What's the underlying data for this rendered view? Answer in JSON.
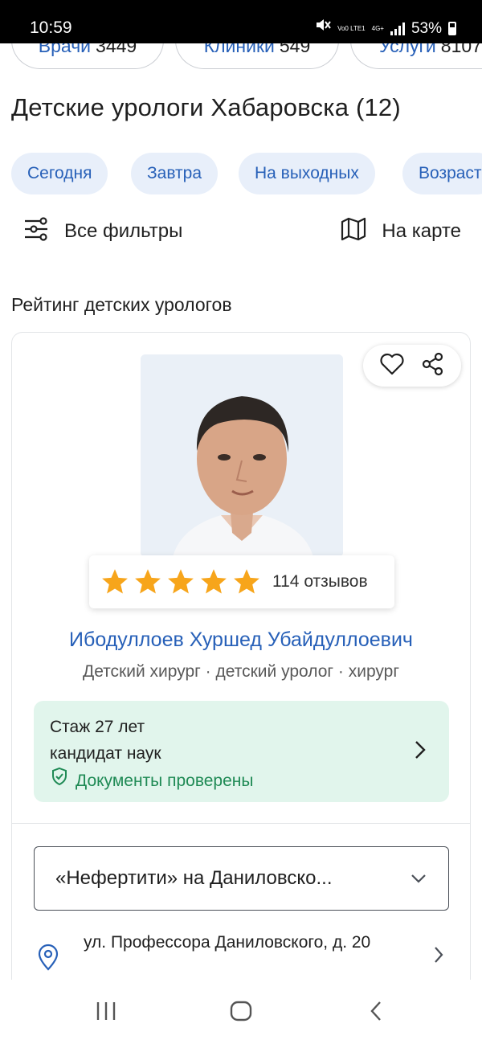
{
  "status_bar": {
    "time": "10:59",
    "battery": "53%",
    "net_top": "Vo0 LTE1",
    "net_right": "4G+"
  },
  "counters": [
    {
      "label": "Врачи",
      "value": "3449"
    },
    {
      "label": "Клиники",
      "value": "549"
    },
    {
      "label": "Услуги",
      "value": "8107"
    }
  ],
  "page_title": "Детские урологи Хабаровска (12)",
  "chips": [
    "Сегодня",
    "Завтра",
    "На выходных",
    "Возраст"
  ],
  "filters": {
    "all_filters": "Все фильтры",
    "on_map": "На карте"
  },
  "section_title": "Рейтинг детских урологов",
  "doctor": {
    "rating_stars": 5,
    "reviews": "114 отзывов",
    "name": "Ибодуллоев Хуршед Убайдуллоевич",
    "specialties": "Детский хирург · детский уролог · хирург",
    "experience": "Стаж 27 лет",
    "degree": "кандидат наук",
    "verified": "Документы проверены",
    "clinic": "«Нефертити» на Даниловско...",
    "address": "ул. Профессора Даниловского, д. 20"
  },
  "colors": {
    "link": "#2760b8",
    "chip_bg": "#e8effa",
    "info_bg": "#e1f5ec",
    "verified": "#1f8a55",
    "star": "#f7a51b"
  }
}
